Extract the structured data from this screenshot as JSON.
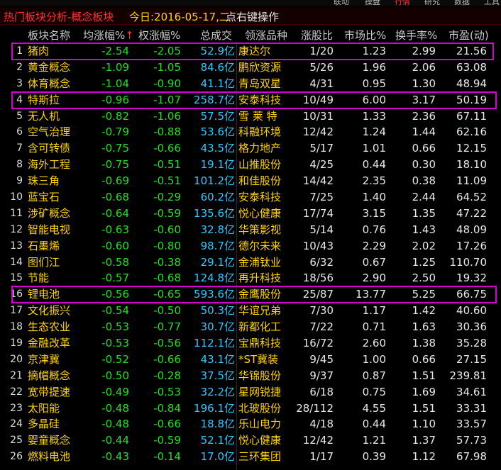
{
  "topbar": {
    "items": [
      "联动",
      "操盘",
      "行情",
      "研究",
      "数据",
      "工具"
    ]
  },
  "title": {
    "text": "热门板块分析-概念板块",
    "date": "今日:2016-05-17,二",
    "hint": "点右键操作"
  },
  "headers": [
    "板块名称",
    "均涨幅%",
    "权涨幅%",
    "总成交",
    "领涨品种",
    "涨股比",
    "市场比%",
    "换手率%",
    "市盈(动)"
  ],
  "sort_marker": "↑",
  "unit": "亿",
  "colors": {
    "highlight_border": "#d400d4",
    "name": "#ffd400",
    "down": "#22e022",
    "amount": "#33c8ff",
    "title_red": "#ff3030"
  },
  "rows": [
    {
      "no": "1",
      "name": "猪肉",
      "avg": "-2.54",
      "wt": "-2.05",
      "amt": "52.9",
      "lead": "康达尔",
      "ratio": "1/20",
      "mkt": "1.23",
      "turn": "2.99",
      "pe": "21.56",
      "hl": true
    },
    {
      "no": "2",
      "name": "黄金概念",
      "avg": "-1.09",
      "wt": "-1.05",
      "amt": "84.6",
      "lead": "鹏欣资源",
      "ratio": "5/26",
      "mkt": "1.96",
      "turn": "2.06",
      "pe": "63.08",
      "hl": false
    },
    {
      "no": "3",
      "name": "体育概念",
      "avg": "-1.04",
      "wt": "-0.90",
      "amt": "41.1",
      "lead": "青岛双星",
      "ratio": "4/31",
      "mkt": "0.95",
      "turn": "1.30",
      "pe": "48.94",
      "hl": false
    },
    {
      "no": "4",
      "name": "特斯拉",
      "avg": "-0.96",
      "wt": "-1.07",
      "amt": "258.7",
      "lead": "安泰科技",
      "ratio": "10/49",
      "mkt": "6.00",
      "turn": "3.17",
      "pe": "50.19",
      "hl": true
    },
    {
      "no": "5",
      "name": "无人机",
      "avg": "-0.82",
      "wt": "-1.06",
      "amt": "57.5",
      "lead": "雪 莱 特",
      "ratio": "10/31",
      "mkt": "1.33",
      "turn": "2.36",
      "pe": "67.11",
      "hl": false
    },
    {
      "no": "6",
      "name": "空气治理",
      "avg": "-0.79",
      "wt": "-0.88",
      "amt": "53.6",
      "lead": "科融环境",
      "ratio": "12/42",
      "mkt": "1.24",
      "turn": "1.44",
      "pe": "62.16",
      "hl": false
    },
    {
      "no": "7",
      "name": "含可转债",
      "avg": "-0.75",
      "wt": "-0.66",
      "amt": "43.5",
      "lead": "格力地产",
      "ratio": "5/17",
      "mkt": "1.01",
      "turn": "0.66",
      "pe": "12.15",
      "hl": false
    },
    {
      "no": "8",
      "name": "海外工程",
      "avg": "-0.75",
      "wt": "-0.51",
      "amt": "19.1",
      "lead": "山推股份",
      "ratio": "4/25",
      "mkt": "0.44",
      "turn": "0.30",
      "pe": "18.10",
      "hl": false
    },
    {
      "no": "9",
      "name": "珠三角",
      "avg": "-0.69",
      "wt": "-0.51",
      "amt": "101.2",
      "lead": "和佳股份",
      "ratio": "14/42",
      "mkt": "2.35",
      "turn": "0.38",
      "pe": "11.09",
      "hl": false
    },
    {
      "no": "10",
      "name": "蓝宝石",
      "avg": "-0.68",
      "wt": "-0.29",
      "amt": "60.2",
      "lead": "安泰科技",
      "ratio": "7/25",
      "mkt": "1.40",
      "turn": "2.44",
      "pe": "64.52",
      "hl": false
    },
    {
      "no": "11",
      "name": "涉矿概念",
      "avg": "-0.64",
      "wt": "-0.59",
      "amt": "135.6",
      "lead": "悦心健康",
      "ratio": "17/74",
      "mkt": "3.15",
      "turn": "1.35",
      "pe": "47.22",
      "hl": false
    },
    {
      "no": "12",
      "name": "智能电视",
      "avg": "-0.63",
      "wt": "-0.60",
      "amt": "32.8",
      "lead": "华策影视",
      "ratio": "5/14",
      "mkt": "0.76",
      "turn": "1.43",
      "pe": "48.09",
      "hl": false
    },
    {
      "no": "13",
      "name": "石墨烯",
      "avg": "-0.60",
      "wt": "-0.80",
      "amt": "98.7",
      "lead": "德尔未来",
      "ratio": "10/43",
      "mkt": "2.29",
      "turn": "2.02",
      "pe": "17.26",
      "hl": false
    },
    {
      "no": "14",
      "name": "图们江",
      "avg": "-0.58",
      "wt": "-0.38",
      "amt": "29.1",
      "lead": "金浦钛业",
      "ratio": "6/32",
      "mkt": "0.67",
      "turn": "1.25",
      "pe": "110.70",
      "hl": false
    },
    {
      "no": "15",
      "name": "节能",
      "avg": "-0.57",
      "wt": "-0.68",
      "amt": "124.8",
      "lead": "再升科技",
      "ratio": "18/56",
      "mkt": "2.90",
      "turn": "2.50",
      "pe": "19.32",
      "hl": false
    },
    {
      "no": "16",
      "name": "锂电池",
      "avg": "-0.56",
      "wt": "-0.65",
      "amt": "593.6",
      "lead": "金鹰股份",
      "ratio": "25/87",
      "mkt": "13.77",
      "turn": "5.25",
      "pe": "66.75",
      "hl": true
    },
    {
      "no": "17",
      "name": "文化振兴",
      "avg": "-0.54",
      "wt": "-0.50",
      "amt": "50.3",
      "lead": "华谊兄弟",
      "ratio": "7/30",
      "mkt": "1.17",
      "turn": "1.42",
      "pe": "40.60",
      "hl": false
    },
    {
      "no": "18",
      "name": "生态农业",
      "avg": "-0.53",
      "wt": "-0.77",
      "amt": "30.7",
      "lead": "新都化工",
      "ratio": "7/22",
      "mkt": "0.71",
      "turn": "1.63",
      "pe": "30.36",
      "hl": false
    },
    {
      "no": "19",
      "name": "金融改革",
      "avg": "-0.53",
      "wt": "-0.56",
      "amt": "112.1",
      "lead": "宝鼎科技",
      "ratio": "16/72",
      "mkt": "2.60",
      "turn": "1.38",
      "pe": "35.28",
      "hl": false
    },
    {
      "no": "20",
      "name": "京津冀",
      "avg": "-0.52",
      "wt": "-0.66",
      "amt": "43.1",
      "lead": "*ST冀装",
      "ratio": "9/45",
      "mkt": "1.00",
      "turn": "0.66",
      "pe": "27.15",
      "hl": false
    },
    {
      "no": "21",
      "name": "摘帽概念",
      "avg": "-0.50",
      "wt": "-0.28",
      "amt": "37.5",
      "lead": "华锦股份",
      "ratio": "9/37",
      "mkt": "0.87",
      "turn": "1.51",
      "pe": "239.81",
      "hl": false
    },
    {
      "no": "22",
      "name": "宽带提速",
      "avg": "-0.49",
      "wt": "-0.53",
      "amt": "32.2",
      "lead": "星网锐捷",
      "ratio": "6/18",
      "mkt": "0.75",
      "turn": "1.69",
      "pe": "34.61",
      "hl": false
    },
    {
      "no": "23",
      "name": "太阳能",
      "avg": "-0.48",
      "wt": "-0.84",
      "amt": "196.1",
      "lead": "北玻股份",
      "ratio": "28/112",
      "mkt": "4.55",
      "turn": "1.51",
      "pe": "33.31",
      "hl": false
    },
    {
      "no": "24",
      "name": "多晶硅",
      "avg": "-0.48",
      "wt": "-0.66",
      "amt": "18.8",
      "lead": "乐山电力",
      "ratio": "4/18",
      "mkt": "0.44",
      "turn": "1.10",
      "pe": "33.57",
      "hl": false
    },
    {
      "no": "25",
      "name": "婴童概念",
      "avg": "-0.44",
      "wt": "-0.59",
      "amt": "52.1",
      "lead": "悦心健康",
      "ratio": "12/42",
      "mkt": "1.21",
      "turn": "1.37",
      "pe": "57.73",
      "hl": false
    },
    {
      "no": "26",
      "name": "燃料电池",
      "avg": "-0.43",
      "wt": "-0.14",
      "amt": "17.0",
      "lead": "三环集团",
      "ratio": "1/17",
      "mkt": "0.39",
      "turn": "1.12",
      "pe": "67.98",
      "hl": false
    }
  ]
}
